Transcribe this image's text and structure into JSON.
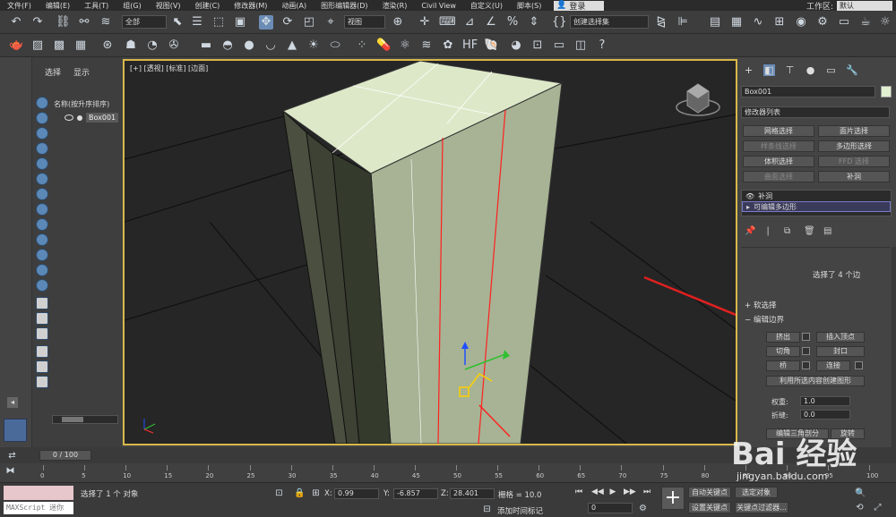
{
  "menubar": {
    "items": [
      "文件(F)",
      "编辑(E)",
      "工具(T)",
      "组(G)",
      "视图(V)",
      "创建(C)",
      "修改器(M)",
      "动画(A)",
      "图形编辑器(D)",
      "渲染(R)",
      "Civil View",
      "自定义(U)",
      "脚本(S)"
    ],
    "login": "登录",
    "workspace_label": "工作区:",
    "workspace_value": "默认"
  },
  "toolbar": {
    "filter_select": "全部",
    "view_select": "视图",
    "selection_set_placeholder": "创建选择集"
  },
  "scene_explorer": {
    "tabs": [
      "选择",
      "显示"
    ],
    "column_header": "名称(按升序排序)",
    "object": "Box001"
  },
  "viewport": {
    "label": "[+] [透视] [标准] [边面]"
  },
  "command_panel": {
    "object_name": "Box001",
    "modifier_list": "修改器列表",
    "modifier_buttons": [
      {
        "label": "网格选择",
        "enabled": true
      },
      {
        "label": "面片选择",
        "enabled": true
      },
      {
        "label": "样条线选择",
        "enabled": false
      },
      {
        "label": "多边形选择",
        "enabled": true
      },
      {
        "label": "体积选择",
        "enabled": true
      },
      {
        "label": "FFD 选择",
        "enabled": false
      },
      {
        "label": "曲面选择",
        "enabled": false
      },
      {
        "label": "补洞",
        "enabled": true
      }
    ],
    "stack": [
      "补洞",
      "可编辑多边形"
    ],
    "selection_info": "选择了 4 个边",
    "soft_selection": "软选择",
    "edit_borders": "编辑边界",
    "buttons": {
      "extrude": "挤出",
      "insert_vertex": "插入顶点",
      "chamfer": "切角",
      "cap": "封口",
      "bridge": "桥",
      "connect": "连接",
      "create_shape": "利用所选内容创建图形",
      "retriangulate": "编辑三角剖分",
      "turn": "旋转"
    },
    "weight_label": "权重:",
    "weight_value": "1.0",
    "crease_label": "折缝:",
    "crease_value": "0.0"
  },
  "timeline": {
    "frame": "0 / 100",
    "ticks": [
      "0",
      "5",
      "10",
      "15",
      "20",
      "25",
      "30",
      "35",
      "40",
      "45",
      "50",
      "55",
      "60",
      "65",
      "70",
      "75",
      "80",
      "85",
      "90",
      "95",
      "100"
    ]
  },
  "statusbar": {
    "maxscript": "MAXScript 迷你",
    "selected": "选择了 1 个 对象",
    "x_label": "X:",
    "x_value": "0.99",
    "y_label": "Y:",
    "y_value": "-6.857",
    "z_label": "Z:",
    "z_value": "28.401",
    "grid": "栅格 = 10.0",
    "add_time_tag": "添加时间标记",
    "auto_key": "自动关键点",
    "selected_object": "选定对象",
    "set_key": "设置关键点",
    "key_filters": "关键点过滤器...",
    "frame_field": "0"
  },
  "watermark": {
    "brand": "Bai 经验",
    "url": "jingyan.baidu.com"
  }
}
